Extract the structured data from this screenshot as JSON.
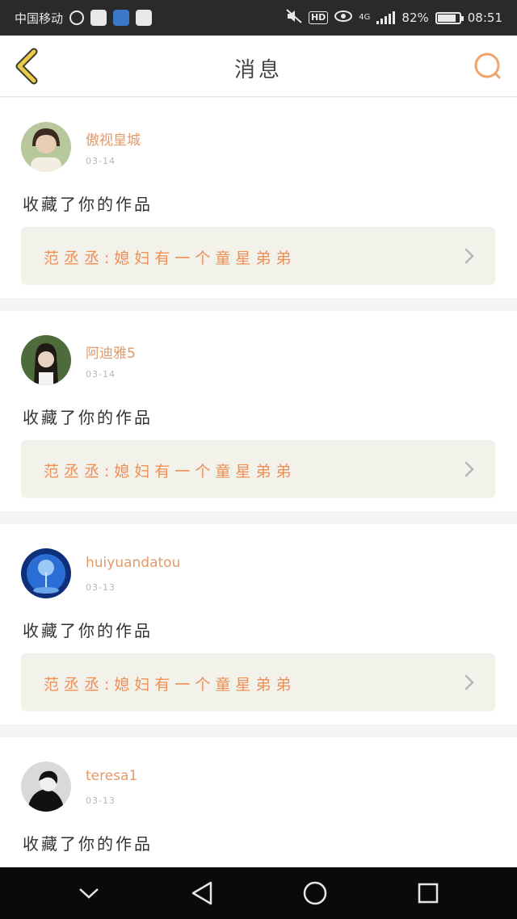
{
  "status_bar": {
    "carrier": "中国移动",
    "network": "4G",
    "hd": "HD",
    "battery": "82%",
    "time": "08:51"
  },
  "header": {
    "title": "消息",
    "back_icon": "chevron-left-icon",
    "search_icon": "search-icon"
  },
  "messages": [
    {
      "user": "傲视皇城",
      "date": "03-14",
      "action": "收藏了你的作品",
      "work": "范丞丞:媳妇有一个童星弟弟",
      "avatar_color": "#8fa67a"
    },
    {
      "user": "阿迪雅5",
      "date": "03-14",
      "action": "收藏了你的作品",
      "work": "范丞丞:媳妇有一个童星弟弟",
      "avatar_color": "#4e6b3c"
    },
    {
      "user": "huiyuandatou",
      "date": "03-13",
      "action": "收藏了你的作品",
      "work": "范丞丞:媳妇有一个童星弟弟",
      "avatar_color": "#1e4fa8"
    },
    {
      "user": "teresa1",
      "date": "03-13",
      "action": "收藏了你的作品",
      "work": "",
      "avatar_color": "#444444"
    }
  ],
  "colors": {
    "accent": "#ef8f58",
    "username": "#e39a6a",
    "card_bg": "#f3f2ea"
  }
}
